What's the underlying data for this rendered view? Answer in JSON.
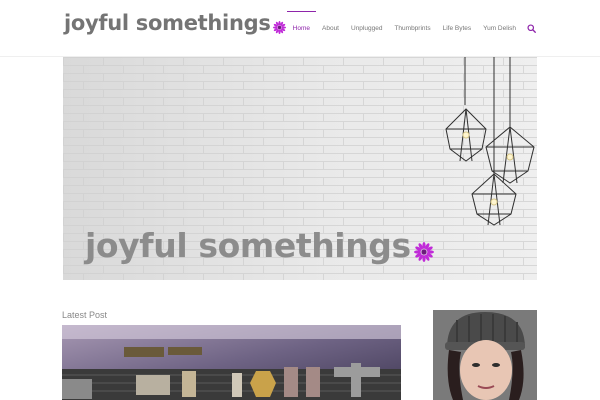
{
  "site": {
    "logo_text": "joyful somethings"
  },
  "nav": {
    "items": [
      {
        "label": "Home",
        "active": true
      },
      {
        "label": "About",
        "active": false
      },
      {
        "label": "Unplugged",
        "active": false
      },
      {
        "label": "Thumbprints",
        "active": false
      },
      {
        "label": "Life Bytes",
        "active": false
      },
      {
        "label": "Yum Delish",
        "active": false
      }
    ],
    "search_icon": "search-icon"
  },
  "hero": {
    "title": "joyful somethings"
  },
  "content": {
    "section_label": "Latest Post"
  },
  "colors": {
    "accent": "#8e24aa",
    "logo_gray": "#747474",
    "flower": "#c02bd8"
  }
}
